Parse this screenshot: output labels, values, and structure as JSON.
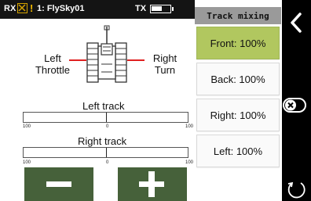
{
  "status_bar": {
    "rx_label": "RX",
    "warning_glyph": "!",
    "model_name": "1: FlySky01",
    "tx_label": "TX",
    "tx_battery_level": 0.6
  },
  "title": "Track mixing",
  "diagram": {
    "left_label_line1": "Left",
    "left_label_line2": "Throttle",
    "right_label_line1": "Right",
    "right_label_line2": "Turn"
  },
  "tracks": {
    "left": {
      "title": "Left track",
      "min_label": "100",
      "mid_label": "0",
      "max_label": "100"
    },
    "right": {
      "title": "Right track",
      "min_label": "100",
      "mid_label": "0",
      "max_label": "100"
    }
  },
  "mix_buttons": [
    {
      "label": "Front: 100%",
      "selected": true
    },
    {
      "label": "Back: 100%",
      "selected": false
    },
    {
      "label": "Right: 100%",
      "selected": false
    },
    {
      "label": "Left: 100%",
      "selected": false
    }
  ],
  "icons": {
    "back": "chevron-left-icon",
    "toggle": "toggle-x-icon",
    "reset": "rotate-icon",
    "minus": "minus-icon",
    "plus": "plus-icon",
    "tank": "tank-icon"
  },
  "colors": {
    "selected": "#b1c75f",
    "action_button": "#46613a",
    "accent_line": "#e02020",
    "title_tab": "#9a9a9a",
    "warning": "#f0b800"
  }
}
